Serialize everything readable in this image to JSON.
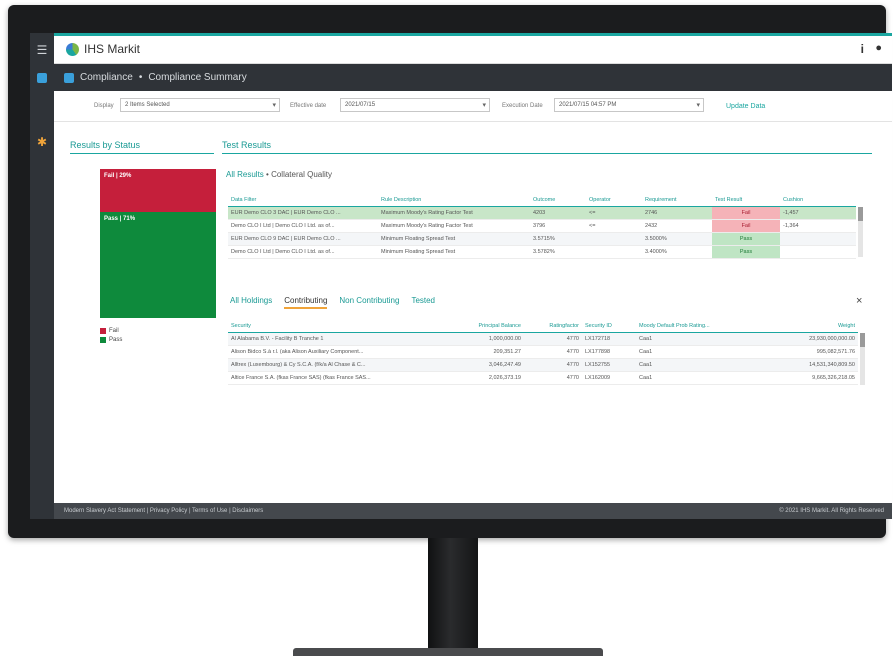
{
  "app": {
    "brand": "IHS Markit"
  },
  "nav": {
    "breadcrumb": [
      "Compliance",
      "Compliance Summary"
    ],
    "separator": "•"
  },
  "filters": {
    "display_label": "Display",
    "display_value": "2 Items Selected",
    "effective_date_label": "Effective date",
    "effective_date_value": "2021/07/15",
    "execution_date_label": "Execution Date",
    "execution_date_value": "2021/07/15 04:57 PM",
    "update_label": "Update Data"
  },
  "results_by_status": {
    "title": "Results by Status",
    "fail_label": "Fail | 29%",
    "pass_label": "Pass | 71%",
    "fail_pct": 29,
    "pass_pct": 71,
    "legend": [
      "Fail",
      "Pass"
    ],
    "colors": {
      "fail": "#c51f3b",
      "pass": "#0e8a3c"
    }
  },
  "test_results": {
    "title": "Test Results",
    "breadcrumb_root": "All Results",
    "breadcrumb_sep": "•",
    "breadcrumb_current": "Collateral Quality",
    "columns": [
      "Data Filter",
      "Rule Description",
      "Outcome",
      "Operator",
      "Requirement",
      "Test Result",
      "Cushion"
    ],
    "rows": [
      [
        "EUR Demo CLO 3 DAC | EUR Demo CLO ...",
        "Maximum Moody's Rating Factor Test",
        "4203",
        "<=",
        "2746",
        "Fail",
        "-1,457"
      ],
      [
        "Demo CLO I Ltd | Demo CLO I Ltd. as of...",
        "Maximum Moody's Rating Factor Test",
        "3796",
        "<=",
        "2432",
        "Fail",
        "-1,364"
      ],
      [
        "EUR Demo CLO 9 DAC | EUR Demo CLO ...",
        "Minimum Floating Spread Test",
        "3.5715%",
        "",
        "3.5000%",
        "Pass",
        ""
      ],
      [
        "Demo CLO I Ltd | Demo CLO I Ltd. as of...",
        "Minimum Floating Spread Test",
        "3.5782%",
        "",
        "3.4000%",
        "Pass",
        ""
      ]
    ]
  },
  "holdings": {
    "tabs": [
      "All Holdings",
      "Contributing",
      "Non Contributing",
      "Tested"
    ],
    "active_tab": "Contributing",
    "close": "×",
    "columns": [
      "Security",
      "Principal Balance",
      "Ratingfactor",
      "Security ID",
      "Moody Default Prob Rating...",
      "Weight"
    ],
    "rows": [
      [
        "Al Alabama B.V. - Facility B Tranche 1",
        "1,000,000.00",
        "4770",
        "LX172718",
        "Caa1",
        "23,930,000,000.00"
      ],
      [
        "Alison Bidco S.à r.l. (aka Alison Auxiliary Component...",
        "209,351.27",
        "4770",
        "LX177898",
        "Caa1",
        "995,082,571.76"
      ],
      [
        "Alltrex (Luxembourg) & Cy S.C.A. (f/k/a Al Chase & C...",
        "3,046,247.49",
        "4770",
        "LX152755",
        "Caa1",
        "14,531,340,809.50"
      ],
      [
        "Altice France S.A. (fkas France SAS) (fkas France SAS...",
        "2,026,373.19",
        "4770",
        "LX162009",
        "Caa1",
        "9,665,326,218.05"
      ]
    ]
  },
  "footer": {
    "links": "Modern Slavery Act Statement  |  Privacy Policy  |  Terms of Use  |  Disclaimers",
    "copyright": "© 2021 IHS Markit. All Rights Reserved"
  }
}
